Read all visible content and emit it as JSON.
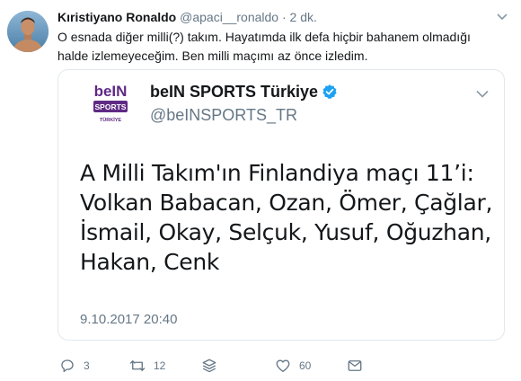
{
  "tweet": {
    "name": "Kıristiyano Ronaldo",
    "handle": "@apaci__ronaldo",
    "separator": "·",
    "time": "2 dk.",
    "text": "O esnada diğer milli(?) takım. Hayatımda ilk defa hiçbir bahanem olmadığı halde izlemeyeceğim. Ben milli maçımı az önce izledim."
  },
  "quoted": {
    "name": "beIN SPORTS Türkiye",
    "handle": "@beINSPORTS_TR",
    "lines": [
      "A Milli Takım'ın Finlandiya maçı 11’i:",
      "Volkan Babacan, Ozan, Ömer, Çağlar,",
      "İsmail, Okay, Selçuk, Yusuf, Oğuzhan,",
      "Hakan, Cenk"
    ],
    "date": "9.10.2017 20:40",
    "logo": {
      "brand": "beIN",
      "line2": "SPORTS",
      "line3": "TÜRKİYE"
    }
  },
  "actions": {
    "reply_count": "3",
    "retweet_count": "12",
    "like_count": "60"
  },
  "icons": [
    "avatar",
    "chevron-down-icon",
    "verified-badge-icon",
    "reply-icon",
    "retweet-icon",
    "stack-icon",
    "like-icon",
    "direct-message-icon"
  ],
  "colors": {
    "text": "#14171a",
    "muted": "#657786",
    "border": "#e1e8ed",
    "verified": "#1da1f2",
    "bein_purple": "#5f2a84"
  }
}
